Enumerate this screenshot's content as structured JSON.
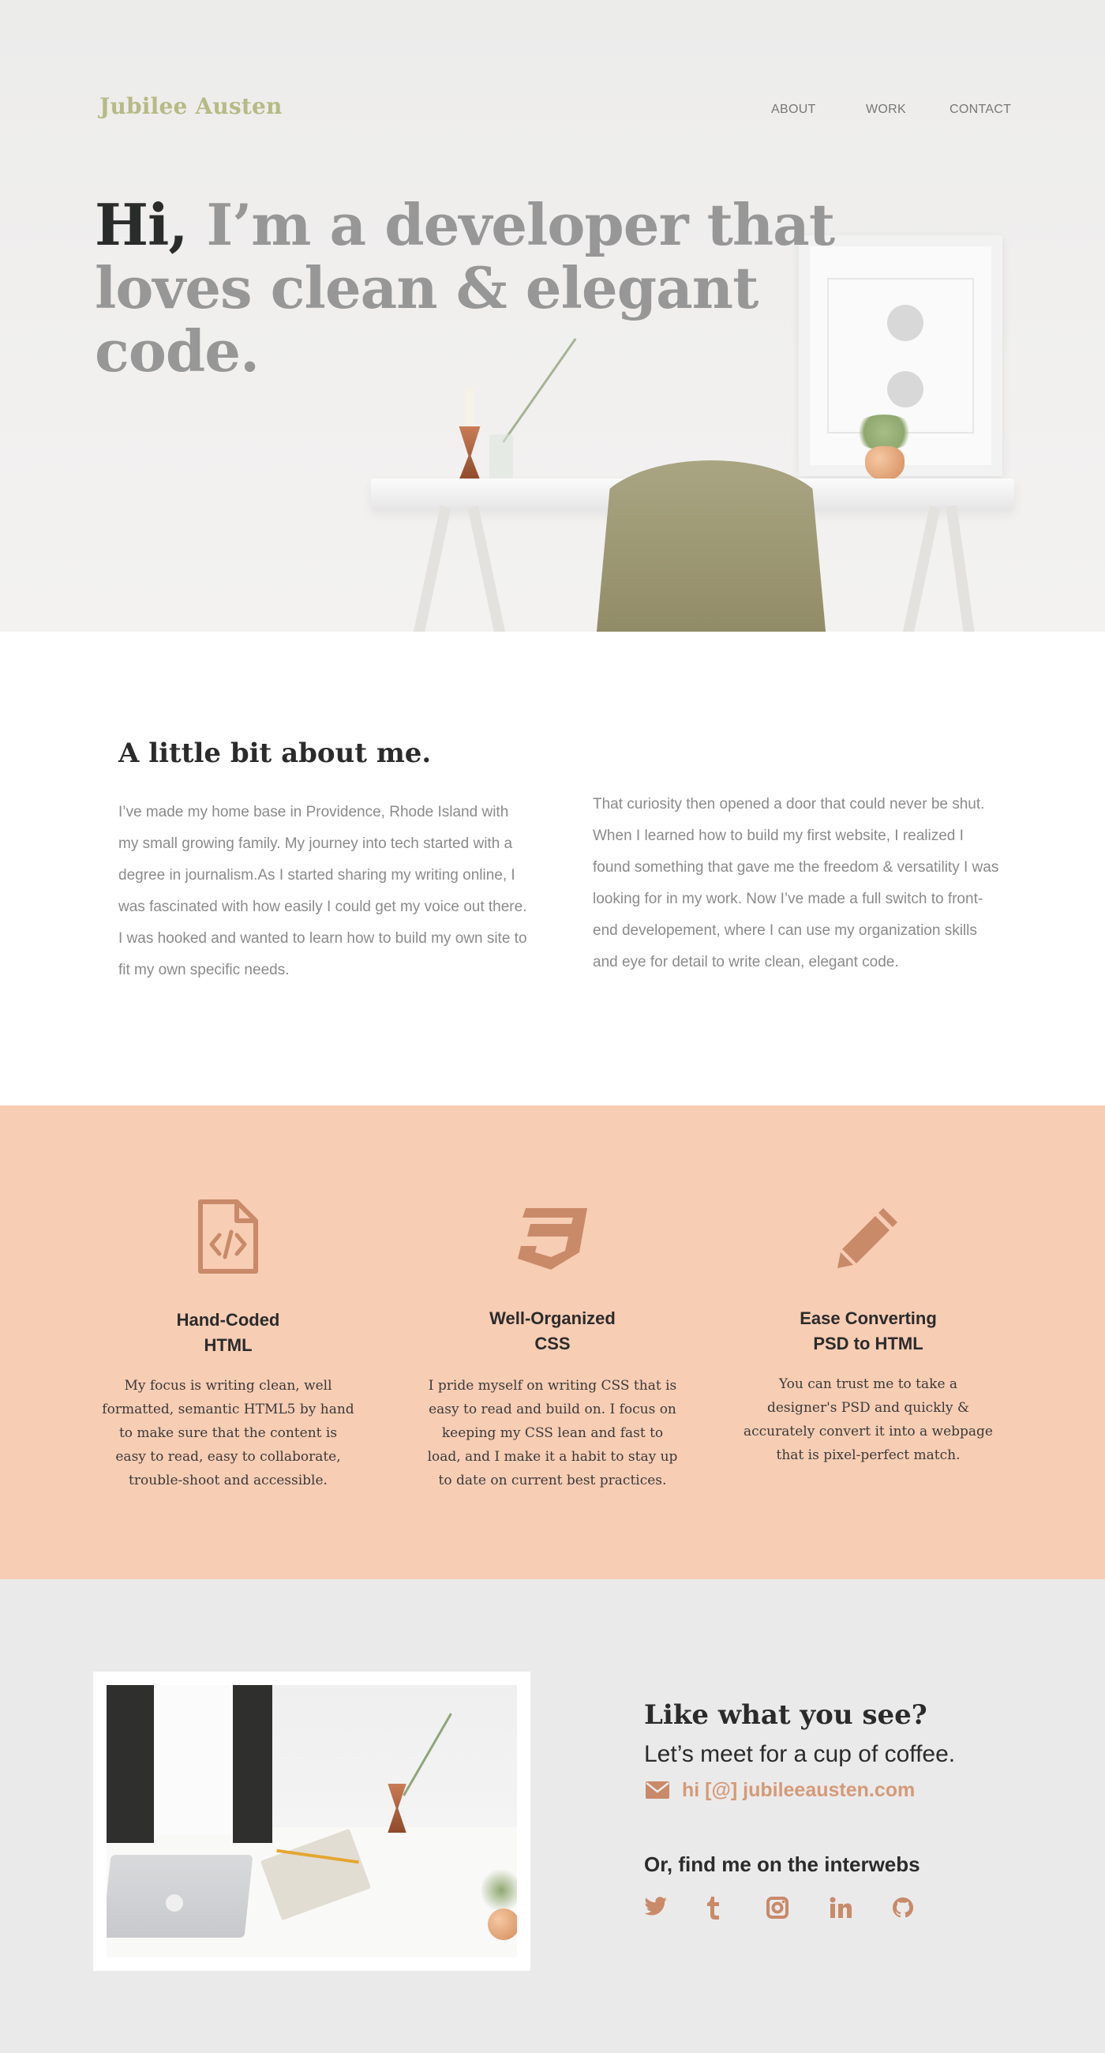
{
  "header": {
    "logo": "Jubilee Austen",
    "nav": [
      "ABOUT",
      "WORK",
      "CONTACT"
    ]
  },
  "hero": {
    "greeting": "Hi,",
    "headline_rest": "I’m a developer that loves clean & elegant code."
  },
  "about": {
    "title": "A little bit about me.",
    "paragraph_1": "I’ve made my home base in Providence, Rhode Island with my small growing family. My journey into tech started with a degree in journalism.As I started sharing my writing online, I was fascinated with how easily I could get my voice out there. I was hooked and wanted to learn how to build my own site to fit my own specific needs.",
    "paragraph_2": "That curiosity then opened a door that could never be shut. When I learned how to build my first website, I realized I found something that gave me the freedom & versatility I was looking for in my work. Now I’ve made a full switch to front-end developement, where I can use my organization skills and eye for detail to write clean, elegant code."
  },
  "skills": [
    {
      "icon": "file-code-icon",
      "title_line1": "Hand-Coded",
      "title_line2": "HTML",
      "text": "My focus is writing clean, well formatted, semantic HTML5 by hand to make sure that the content is easy to read, easy to collaborate, trouble-shoot and accessible."
    },
    {
      "icon": "css3-icon",
      "title_line1": "Well-Organized",
      "title_line2": "CSS",
      "text": "I pride myself on writing CSS that is easy to read and build on. I focus on keeping my CSS lean and fast to load, and I make it a habit to stay up to date on current best practices."
    },
    {
      "icon": "pencil-icon",
      "title_line1": "Ease Converting",
      "title_line2": "PSD to HTML",
      "text": "You can trust me to take a designer's PSD and quickly & accurately convert it into a webpage that is pixel-perfect match."
    }
  ],
  "contact": {
    "title": "Like what you see?",
    "subtitle": "Let’s meet for a cup of coffee.",
    "email": "hi [@] jubileeausten.com",
    "find_me": "Or, find me on the interwebs",
    "socials": [
      "twitter-icon",
      "tumblr-icon",
      "instagram-icon",
      "linkedin-icon",
      "github-icon"
    ]
  },
  "colors": {
    "logo": "#b6ba84",
    "accent_peach": "#f7cdb4",
    "icon_copper": "#c98a6a",
    "link": "#d39a79"
  }
}
